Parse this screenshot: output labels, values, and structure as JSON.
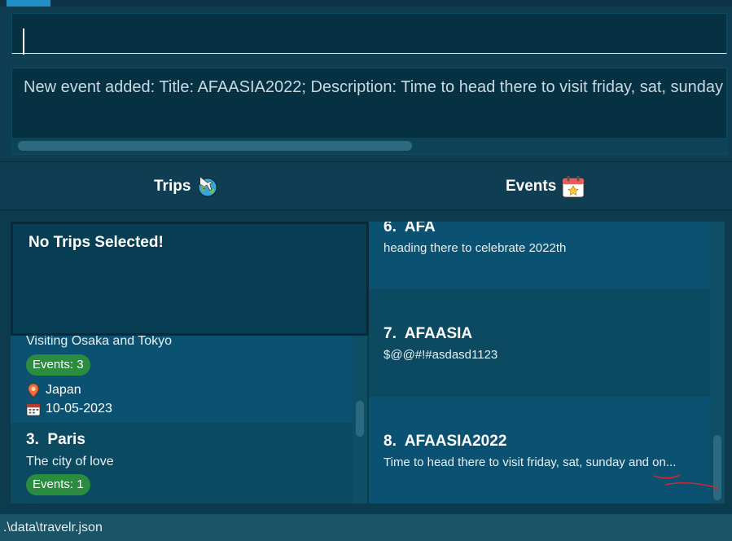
{
  "command": {
    "value": ""
  },
  "result": {
    "text": "New event added: Title: AFAASIA2022; Description: Time to head there to visit  friday, sat, sunday and on..."
  },
  "tabs": [
    {
      "label": "Trips",
      "icon": "globe-plane-icon"
    },
    {
      "label": "Events",
      "icon": "calendar-star-icon"
    }
  ],
  "no_trip": {
    "label": "No Trips Selected!"
  },
  "trips": [
    {
      "description": "Visiting Osaka and Tokyo",
      "events_badge": "Events: 3",
      "location": "Japan",
      "date": "10-05-2023"
    },
    {
      "index": "3.",
      "title": "Paris",
      "description": "The city of love",
      "events_badge": "Events: 1"
    }
  ],
  "events": [
    {
      "index": "6.",
      "title": "AFA",
      "description": "heading there to celebrate 2022th"
    },
    {
      "index": "7.",
      "title": "AFAASIA",
      "description": "$@@#!#asdasd1123"
    },
    {
      "index": "8.",
      "title": "AFAASIA2022",
      "description": "Time to head there to visit  friday, sat, sunday and on..."
    }
  ],
  "status": {
    "path": ".\\data\\travelr.json"
  },
  "colors": {
    "badge": "#2a8c3e",
    "accent": "#1f8fc4",
    "annotation": "#d9262b"
  }
}
